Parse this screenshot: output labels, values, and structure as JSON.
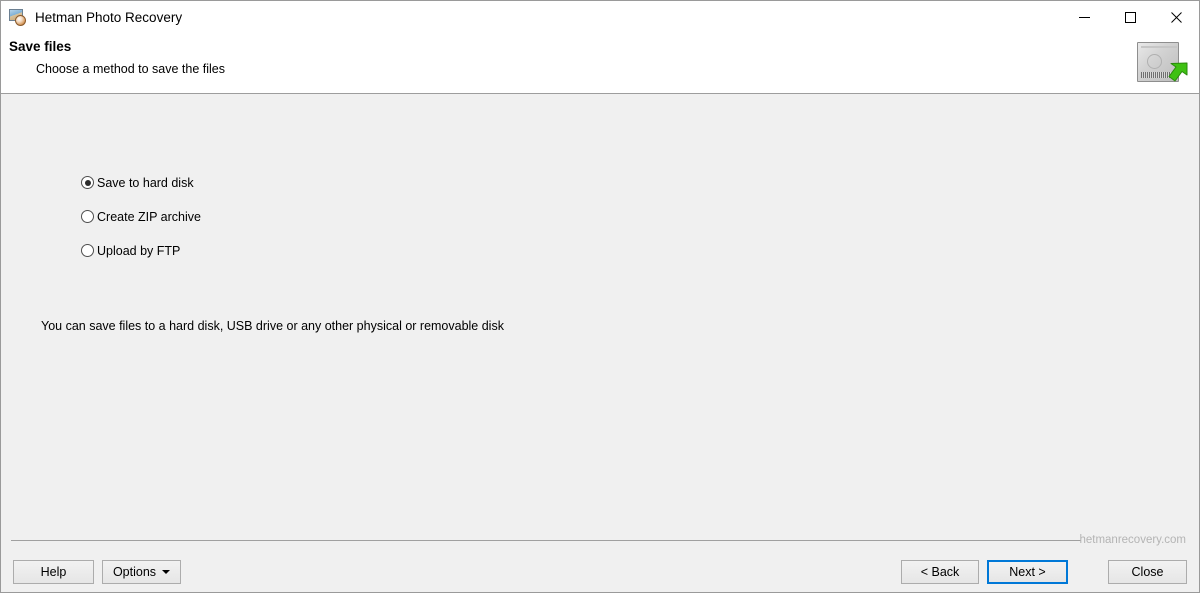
{
  "window": {
    "title": "Hetman Photo Recovery",
    "app_icon": "photo-camera-icon",
    "controls": {
      "minimize": "minimize-icon",
      "maximize": "maximize-icon",
      "close": "close-icon"
    }
  },
  "header": {
    "title": "Save files",
    "subtitle": "Choose a method to save the files",
    "graphic": "hard-disk-with-green-arrow-icon"
  },
  "main": {
    "options": [
      {
        "label": "Save to hard disk",
        "selected": true
      },
      {
        "label": "Create ZIP archive",
        "selected": false
      },
      {
        "label": "Upload by FTP",
        "selected": false
      }
    ],
    "description": "You can save files to a hard disk, USB drive or any other physical or removable disk"
  },
  "footer": {
    "watermark": "hetmanrecovery.com",
    "buttons": {
      "help": "Help",
      "options": "Options",
      "back": "< Back",
      "next": "Next >",
      "close": "Close"
    }
  },
  "colors": {
    "accent": "#0078d7",
    "window_background": "#f0f0f0",
    "header_background": "#ffffff",
    "watermark_text": "#b4b4b4"
  }
}
